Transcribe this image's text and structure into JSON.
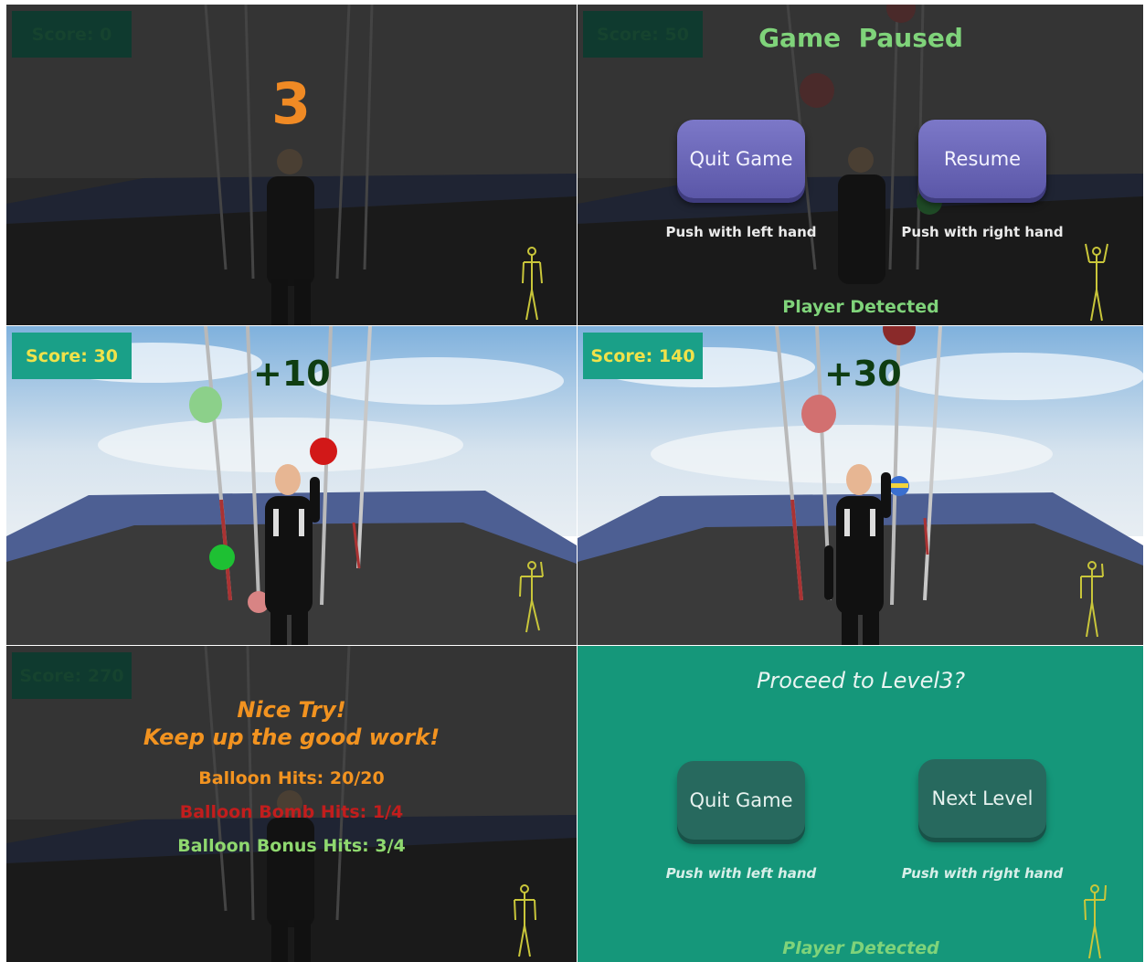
{
  "panels": {
    "countdown": {
      "score": "Score: 0",
      "count": "3"
    },
    "paused": {
      "score": "Score: 50",
      "title": "Game  Paused",
      "quit_label": "Quit Game",
      "resume_label": "Resume",
      "quit_hint": "Push with left hand",
      "resume_hint": "Push with right hand",
      "status": "Player Detected"
    },
    "play1": {
      "score": "Score: 30",
      "points": "+10"
    },
    "play2": {
      "score": "Score: 140",
      "points": "+30"
    },
    "results": {
      "score": "Score: 270",
      "line1": "Nice Try!",
      "line2": "Keep up the good work!",
      "balloon_hits": "Balloon Hits: 20/20",
      "bomb_hits": "Balloon Bomb Hits: 1/4",
      "bonus_hits": "Balloon Bonus Hits: 3/4"
    },
    "proceed": {
      "title": "Proceed to Level3?",
      "quit_label": "Quit Game",
      "next_label": "Next Level",
      "quit_hint": "Push with left hand",
      "next_hint": "Push with right hand",
      "status": "Player Detected"
    }
  },
  "colors": {
    "score_box": "#1aa088",
    "score_text": "#f0e24a",
    "countdown": "#f08a24",
    "points": "#0f3d12",
    "paused_title": "#7fd37a",
    "results_orange": "#f29320",
    "results_red": "#c21d1d",
    "results_green": "#8fd86f",
    "proceed_bg": "#15977a"
  },
  "icons": [
    "balloon-icon",
    "player-skeleton-icon",
    "avatar-figure-icon"
  ]
}
